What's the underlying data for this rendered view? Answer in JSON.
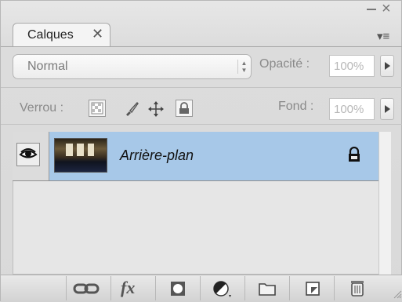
{
  "tabs": {
    "active_label": "Calques",
    "close_glyph": "✕"
  },
  "window": {
    "minimize_glyph": "–",
    "close_glyph": "×",
    "panel_menu_glyph": "▾≡"
  },
  "blend": {
    "mode": "Normal",
    "opacity_label": "Opacité :",
    "opacity_value": "100%"
  },
  "locks": {
    "label": "Verrou :",
    "fill_label": "Fond :",
    "fill_value": "100%",
    "icons": [
      "lock-transparency-icon",
      "lock-paint-icon",
      "lock-position-icon",
      "lock-all-icon"
    ]
  },
  "layers": [
    {
      "name": "Arrière-plan",
      "visible": true,
      "locked": true,
      "selected": true
    }
  ],
  "footer_buttons": [
    "link-layers-icon",
    "layer-style-fx-icon",
    "add-mask-icon",
    "adjustment-layer-icon",
    "new-group-icon",
    "new-layer-icon",
    "trash-icon"
  ],
  "footer_fx_glyph": "fx",
  "colors": {
    "selected_row": "#a7c8e8",
    "panel_bg": "#dcdcdc"
  }
}
